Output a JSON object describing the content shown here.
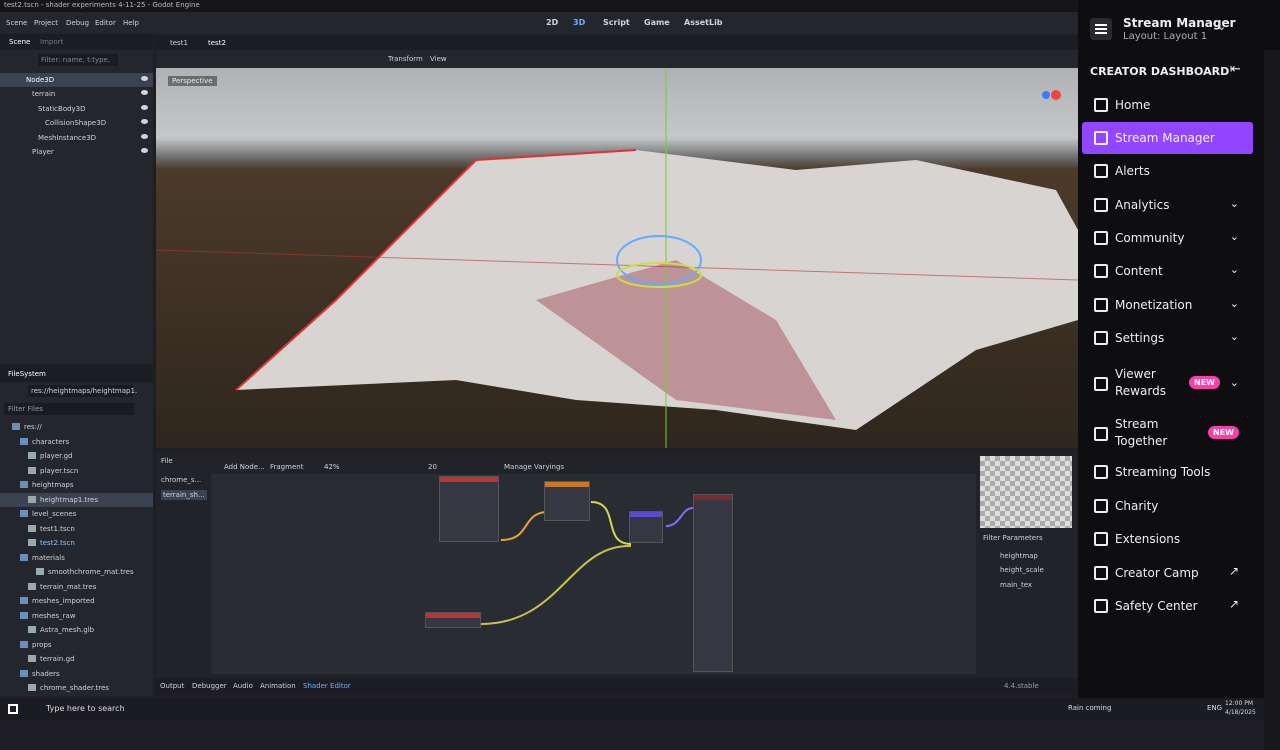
{
  "window": {
    "title": "test2.tscn - shader experiments 4-11-25 - Godot Engine"
  },
  "menu": {
    "items": [
      "Scene",
      "Project",
      "Debug",
      "Editor",
      "Help"
    ]
  },
  "workspaces": [
    "2D",
    "3D",
    "Script",
    "Game",
    "AssetLib"
  ],
  "scene_dock": {
    "tabs": [
      "Scene",
      "Import"
    ],
    "filter_placeholder": "Filter: name, t:type,",
    "nodes": [
      "Node3D",
      "terrain",
      "StaticBody3D",
      "CollisionShape3D",
      "MeshInstance3D",
      "Player"
    ]
  },
  "scene_tabs": [
    "test1",
    "test2"
  ],
  "viewport": {
    "tools": [
      "Transform",
      "View"
    ],
    "perspective_label": "Perspective"
  },
  "filesystem": {
    "title": "FileSystem",
    "path": "res://heightmaps/heightmap1.",
    "filter_placeholder": "Filter Files",
    "items": [
      "res://",
      "characters",
      "player.gd",
      "player.tscn",
      "heightmaps",
      "heightmap1.tres",
      "level_scenes",
      "test1.tscn",
      "test2.tscn",
      "materials",
      "smoothchrome_mat.tres",
      "terrain_mat.tres",
      "meshes_imported",
      "meshes_raw",
      "Astra_mesh.glb",
      "props",
      "terrain.gd",
      "shaders",
      "chrome_shader.tres"
    ]
  },
  "shader_editor": {
    "file_label": "File",
    "files": [
      "chrome_s...",
      "terrain_sh..."
    ],
    "add_node": "Add Node...",
    "mode": "Fragment",
    "zoom": "42%",
    "snap": "20",
    "manage": "Manage Varyings",
    "filter_params": "Filter Parameters",
    "params": [
      "heightmap",
      "height_scale",
      "main_tex"
    ]
  },
  "bottom_tabs": [
    "Output",
    "Debugger",
    "Audio",
    "Animation",
    "Shader Editor"
  ],
  "version": "4.4.stable",
  "taskbar": {
    "search": "Type here to search",
    "weather": "Rain coming",
    "lang": "ENG",
    "time": "12:00 PM",
    "date": "4/18/2025"
  },
  "twitch": {
    "title": "Stream Manager",
    "layout": "Layout: Layout 1",
    "dashboard": "CREATOR DASHBOARD",
    "nav": [
      {
        "label": "Home",
        "icon": "home-icon"
      },
      {
        "label": "Stream Manager",
        "icon": "broadcast-icon",
        "active": true
      },
      {
        "label": "Alerts",
        "icon": "megaphone-icon"
      },
      {
        "label": "Analytics",
        "icon": "chart-icon",
        "chevron": true
      },
      {
        "label": "Community",
        "icon": "community-icon",
        "chevron": true
      },
      {
        "label": "Content",
        "icon": "content-icon",
        "chevron": true
      },
      {
        "label": "Monetization",
        "icon": "monetization-icon",
        "chevron": true
      },
      {
        "label": "Settings",
        "icon": "gear-icon",
        "chevron": true
      },
      {
        "label": "Viewer",
        "label2": "Rewards",
        "icon": "rewards-icon",
        "badge": "NEW",
        "chevron": true
      },
      {
        "label": "Stream",
        "label2": "Together",
        "icon": "together-icon",
        "badge": "NEW"
      },
      {
        "label": "Streaming Tools",
        "icon": "camera-icon"
      },
      {
        "label": "Charity",
        "icon": "charity-icon"
      },
      {
        "label": "Extensions",
        "icon": "puzzle-icon"
      },
      {
        "label": "Creator Camp",
        "icon": "camp-icon",
        "external": true
      },
      {
        "label": "Safety Center",
        "icon": "shield-icon",
        "external": true
      }
    ],
    "accent": "#9147ff"
  }
}
